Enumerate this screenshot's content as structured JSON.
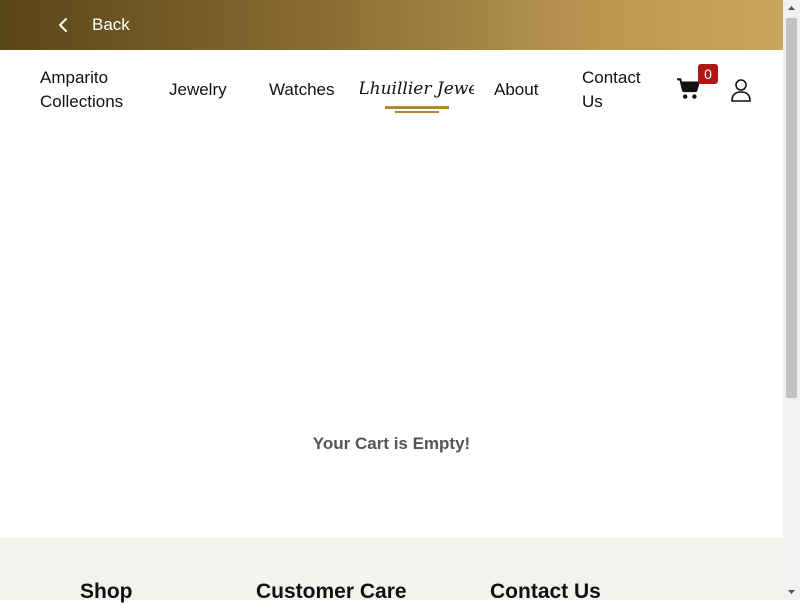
{
  "topbar": {
    "back_label": "Back"
  },
  "nav": {
    "items": [
      {
        "label": "Amparito Collections"
      },
      {
        "label": "Jewelry"
      },
      {
        "label": "Watches"
      },
      {
        "label": "About"
      },
      {
        "label": "Contact Us"
      }
    ],
    "logo_text": "M V Lhuillier Jewellers",
    "cart_count": "0"
  },
  "cart": {
    "empty_message": "Your Cart is Empty!"
  },
  "footer": {
    "headings": [
      "Shop",
      "Customer Care",
      "Contact Us"
    ]
  },
  "colors": {
    "topbar_start": "#5a4519",
    "topbar_end": "#c9a65c",
    "badge": "#b01818"
  },
  "icons": [
    "chevron-left-icon",
    "cart-icon",
    "user-icon"
  ]
}
